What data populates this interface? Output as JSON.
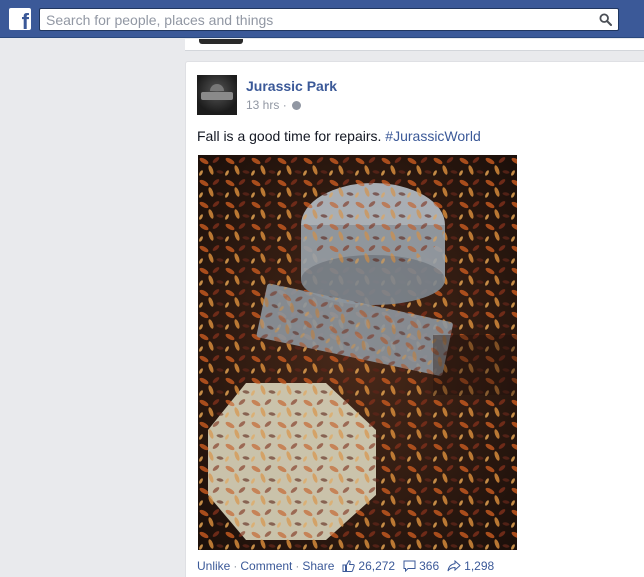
{
  "header": {
    "logo_letter": "f",
    "search_placeholder": "Search for people, places and things"
  },
  "post": {
    "page_name": "Jurassic Park",
    "time": "13 hrs",
    "separator": "·",
    "text": "Fall is a good time for repairs.",
    "hashtag": "#JurassicWorld",
    "actions": {
      "unlike": "Unlike",
      "comment": "Comment",
      "share": "Share",
      "dot": "·"
    },
    "stats": {
      "likes": "26,272",
      "comments": "366",
      "shares": "1,298"
    }
  },
  "colors": {
    "brand": "#3b5998",
    "meta_gray": "#9197a3",
    "background": "#e9eaed"
  },
  "icons": [
    "facebook-logo-icon",
    "search-icon",
    "globe-icon",
    "thumbs-up-icon",
    "comment-icon",
    "share-arrow-icon"
  ]
}
